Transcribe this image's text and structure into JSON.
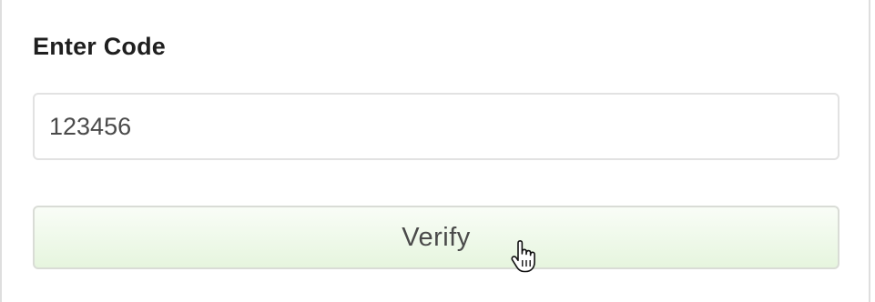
{
  "form": {
    "label": "Enter Code",
    "code_value": "123456",
    "verify_label": "Verify"
  },
  "colors": {
    "button_gradient_top": "#f9fdf7",
    "button_gradient_bottom": "#e6f5de",
    "border": "#e2e2e2",
    "text": "#4a4a4a"
  },
  "icons": {
    "cursor": "hand-pointer-icon"
  }
}
